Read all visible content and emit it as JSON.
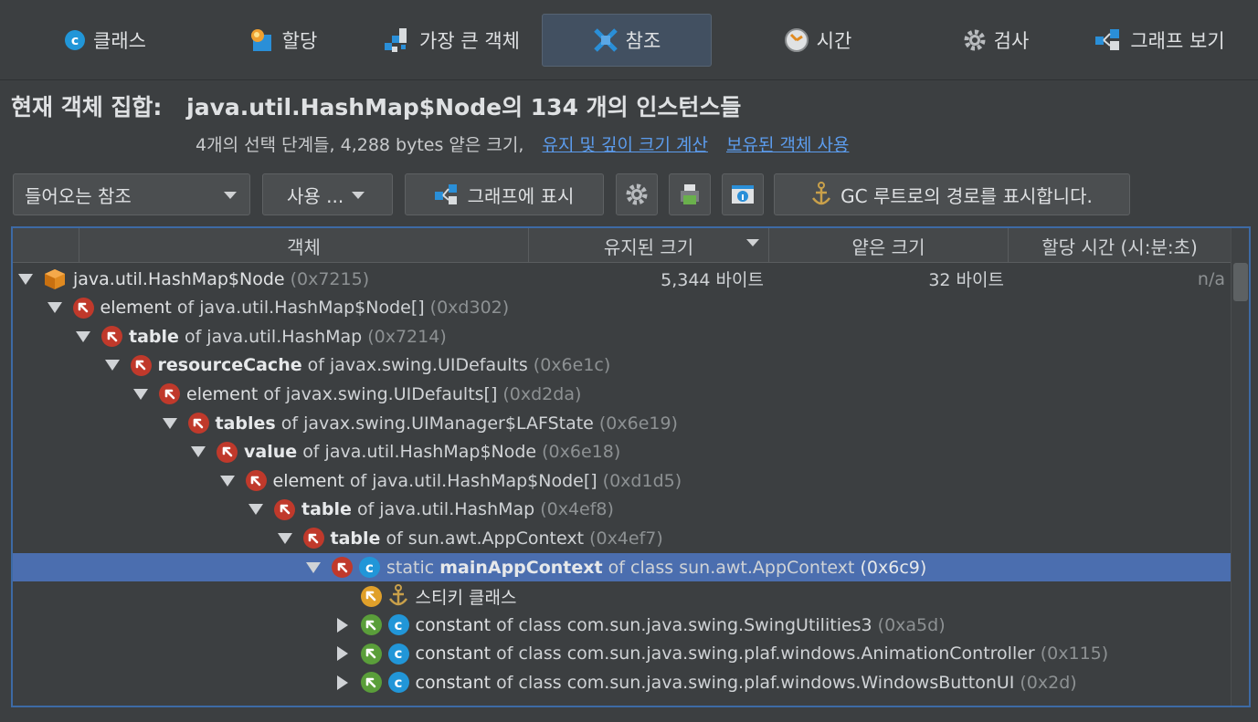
{
  "tabs": [
    {
      "label": "클래스",
      "icon": "class-icon"
    },
    {
      "label": "할당",
      "icon": "allocation-icon"
    },
    {
      "label": "가장 큰 객체",
      "icon": "biggest-objects-icon"
    },
    {
      "label": "참조",
      "icon": "references-icon"
    },
    {
      "label": "시간",
      "icon": "time-icon"
    },
    {
      "label": "검사",
      "icon": "inspections-icon"
    },
    {
      "label": "그래프 보기",
      "icon": "graph-icon"
    }
  ],
  "active_tab": "참조",
  "heading": {
    "label": "현재 객체 집합:",
    "value": "java.util.HashMap$Node의 134 개의 인스턴스들"
  },
  "subheading": {
    "text": "4개의 선택 단계들, 4,288 bytes 얕은 크기,",
    "link1": "유지 및 깊이 크기 계산",
    "link2": "보유된 객체 사용"
  },
  "toolbar": {
    "ref_select": "들어오는 참조",
    "use_menu": "사용 ...",
    "show_graph": "그래프에 표시",
    "gc_path": "GC 루트로의 경로를 표시합니다."
  },
  "table": {
    "columns": [
      "객체",
      "유지된 크기",
      "얕은 크기",
      "할당 시간 (시:분:초)"
    ],
    "sort_column": "유지된 크기",
    "rows": [
      {
        "depth": 0,
        "expand": "down",
        "icons": [
          "cube"
        ],
        "pre": "",
        "name": "java.util.HashMap$Node",
        "bold": false,
        "of": "",
        "id": "(0x7215)",
        "retained": "5,344 바이트",
        "shallow": "32 바이트",
        "time": "n/a"
      },
      {
        "depth": 1,
        "expand": "down",
        "icons": [
          "ref-red"
        ],
        "pre": "",
        "name": "element",
        "bold": false,
        "of": "of java.util.HashMap$Node[]",
        "id": "(0xd302)",
        "retained": "",
        "shallow": "",
        "time": ""
      },
      {
        "depth": 2,
        "expand": "down",
        "icons": [
          "ref-red"
        ],
        "pre": "",
        "name": "table",
        "bold": true,
        "of": "of java.util.HashMap",
        "id": "(0x7214)",
        "retained": "",
        "shallow": "",
        "time": ""
      },
      {
        "depth": 3,
        "expand": "down",
        "icons": [
          "ref-red"
        ],
        "pre": "",
        "name": "resourceCache",
        "bold": true,
        "of": "of javax.swing.UIDefaults",
        "id": "(0x6e1c)",
        "retained": "",
        "shallow": "",
        "time": ""
      },
      {
        "depth": 4,
        "expand": "down",
        "icons": [
          "ref-red"
        ],
        "pre": "",
        "name": "element",
        "bold": false,
        "of": "of javax.swing.UIDefaults[]",
        "id": "(0xd2da)",
        "retained": "",
        "shallow": "",
        "time": ""
      },
      {
        "depth": 5,
        "expand": "down",
        "icons": [
          "ref-red"
        ],
        "pre": "",
        "name": "tables",
        "bold": true,
        "of": "of javax.swing.UIManager$LAFState",
        "id": "(0x6e19)",
        "retained": "",
        "shallow": "",
        "time": ""
      },
      {
        "depth": 6,
        "expand": "down",
        "icons": [
          "ref-red"
        ],
        "pre": "",
        "name": "value",
        "bold": true,
        "of": "of java.util.HashMap$Node",
        "id": "(0x6e18)",
        "retained": "",
        "shallow": "",
        "time": ""
      },
      {
        "depth": 7,
        "expand": "down",
        "icons": [
          "ref-red"
        ],
        "pre": "",
        "name": "element",
        "bold": false,
        "of": "of java.util.HashMap$Node[]",
        "id": "(0xd1d5)",
        "retained": "",
        "shallow": "",
        "time": ""
      },
      {
        "depth": 8,
        "expand": "down",
        "icons": [
          "ref-red"
        ],
        "pre": "",
        "name": "table",
        "bold": true,
        "of": "of java.util.HashMap",
        "id": "(0x4ef8)",
        "retained": "",
        "shallow": "",
        "time": ""
      },
      {
        "depth": 9,
        "expand": "down",
        "icons": [
          "ref-red"
        ],
        "pre": "",
        "name": "table",
        "bold": true,
        "of": "of sun.awt.AppContext",
        "id": "(0x4ef7)",
        "retained": "",
        "shallow": "",
        "time": ""
      },
      {
        "depth": 10,
        "expand": "down",
        "icons": [
          "ref-red",
          "class-c"
        ],
        "pre": "static",
        "name": "mainAppContext",
        "bold": true,
        "of": "of class sun.awt.AppContext",
        "id": "(0x6c9)",
        "retained": "",
        "shallow": "",
        "time": "",
        "selected": true
      },
      {
        "depth": 11,
        "expand": "none",
        "icons": [
          "ref-orange",
          "anchor"
        ],
        "pre": "",
        "name": "스티키 클래스",
        "bold": false,
        "of": "",
        "id": "",
        "retained": "",
        "shallow": "",
        "time": ""
      },
      {
        "depth": 11,
        "expand": "right",
        "icons": [
          "ref-green",
          "class-c"
        ],
        "pre": "",
        "name": "constant",
        "bold": false,
        "of": "of class com.sun.java.swing.SwingUtilities3",
        "id": "(0xa5d)",
        "retained": "",
        "shallow": "",
        "time": ""
      },
      {
        "depth": 11,
        "expand": "right",
        "icons": [
          "ref-green",
          "class-c"
        ],
        "pre": "",
        "name": "constant",
        "bold": false,
        "of": "of class com.sun.java.swing.plaf.windows.AnimationController",
        "id": "(0x115)",
        "retained": "",
        "shallow": "",
        "time": ""
      },
      {
        "depth": 11,
        "expand": "right",
        "icons": [
          "ref-green",
          "class-c"
        ],
        "pre": "",
        "name": "constant",
        "bold": false,
        "of": "of class com.sun.java.swing.plaf.windows.WindowsButtonUI",
        "id": "(0x2d)",
        "retained": "",
        "shallow": "",
        "time": ""
      }
    ]
  }
}
